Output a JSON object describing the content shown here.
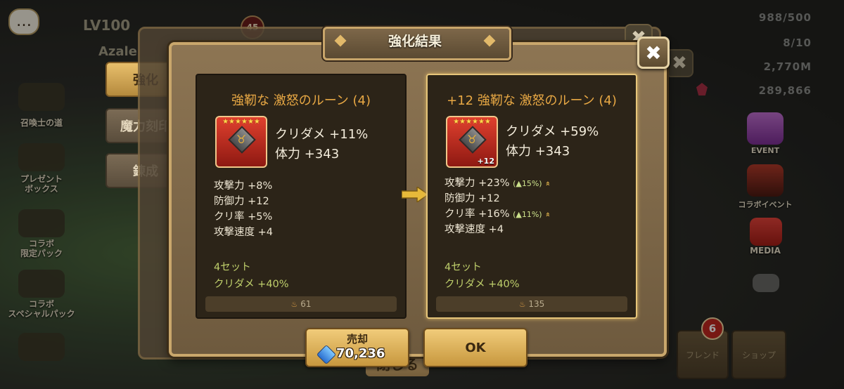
{
  "hud": {
    "level": "LV100",
    "player_name": "Azale",
    "level_badge": "45",
    "stats": [
      "988/500",
      "8/10",
      "2,770M",
      "289,866"
    ]
  },
  "left_menu": {
    "tabs": [
      "強化",
      "魔力刻印",
      "錬成"
    ],
    "icons": [
      "召喚士の道",
      "プレゼント\nボックス",
      "コラボ\n限定パック",
      "コラボ\nスペシャルパック"
    ]
  },
  "right_menu": {
    "items": [
      "EVENT",
      "コラボイベント",
      "MEDIA"
    ],
    "friend_badge": "6"
  },
  "bottom_nav": [
    "フレンド",
    "ショップ"
  ],
  "dialog": {
    "title": "強化結果",
    "close_hint": "閉じる",
    "before": {
      "name": "強靭な 激怒のルーン (4)",
      "stars": "★★★★★★",
      "level": "",
      "main_stats": [
        "クリダメ +11%",
        "体力 +343"
      ],
      "sub_stats": [
        {
          "text": "攻撃力 +8%",
          "gain": "",
          "chevron": ""
        },
        {
          "text": "防御力 +12",
          "gain": "",
          "chevron": ""
        },
        {
          "text": "クリ率 +5%",
          "gain": "",
          "chevron": ""
        },
        {
          "text": "攻撃速度 +4",
          "gain": "",
          "chevron": ""
        }
      ],
      "set_label": "4セット",
      "set_effect": "クリダメ +40%",
      "price": "61"
    },
    "after": {
      "name": "+12 強靭な 激怒のルーン (4)",
      "stars": "★★★★★★",
      "level": "+12",
      "main_stats": [
        "クリダメ +59%",
        "体力 +343"
      ],
      "sub_stats": [
        {
          "text": "攻撃力 +23%",
          "gain": "(▲15%)",
          "chevron": "»"
        },
        {
          "text": "防御力 +12",
          "gain": "",
          "chevron": ""
        },
        {
          "text": "クリ率 +16%",
          "gain": "(▲11%)",
          "chevron": "»"
        },
        {
          "text": "攻撃速度 +4",
          "gain": "",
          "chevron": ""
        }
      ],
      "set_label": "4セット",
      "set_effect": "クリダメ +40%",
      "price": "135"
    },
    "sell_label": "売却",
    "sell_price": "70,236",
    "ok_label": "OK"
  },
  "icons": {
    "chat": "chat-bubble-icon",
    "rune_glyph": "♉",
    "price": "🔥",
    "close": "✖"
  },
  "colors": {
    "accent_gold": "#e8a844",
    "set_green": "#bfcf6b",
    "button_gold": "#e0b35c"
  }
}
